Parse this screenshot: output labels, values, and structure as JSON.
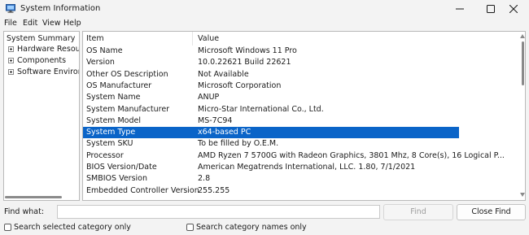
{
  "window": {
    "title": "System Information",
    "app_icon": "system-information-icon",
    "controls": [
      "minimize-icon",
      "maximize-icon",
      "close-icon"
    ]
  },
  "menu": [
    "File",
    "Edit",
    "View",
    "Help"
  ],
  "tree": {
    "root": "System Summary",
    "children": [
      "Hardware Resource",
      "Components",
      "Software Environme"
    ]
  },
  "list": {
    "columns": {
      "item": "Item",
      "value": "Value"
    },
    "selected_row": 8,
    "rows": [
      {
        "item": "OS Name",
        "value": "Microsoft Windows 11 Pro"
      },
      {
        "item": "Version",
        "value": "10.0.22621 Build 22621"
      },
      {
        "item": "Other OS Description",
        "value": "Not Available"
      },
      {
        "item": "OS Manufacturer",
        "value": "Microsoft Corporation"
      },
      {
        "item": "System Name",
        "value": "ANUP"
      },
      {
        "item": "System Manufacturer",
        "value": "Micro-Star International Co., Ltd."
      },
      {
        "item": "System Model",
        "value": "MS-7C94"
      },
      {
        "item": "System Type",
        "value": "x64-based PC"
      },
      {
        "item": "System SKU",
        "value": "To be filled by O.E.M."
      },
      {
        "item": "Processor",
        "value": "AMD Ryzen 7 5700G with Radeon Graphics, 3801 Mhz, 8 Core(s), 16 Logical P..."
      },
      {
        "item": "BIOS Version/Date",
        "value": "American Megatrends International, LLC. 1.80, 7/1/2021"
      },
      {
        "item": "SMBIOS Version",
        "value": "2.8"
      },
      {
        "item": "Embedded Controller Version",
        "value": "255.255"
      }
    ]
  },
  "find": {
    "label": "Find what:",
    "value": "",
    "find_button": "Find",
    "close_button": "Close Find",
    "search_selected": "Search selected category only",
    "search_names": "Search category names only"
  },
  "colors": {
    "selection": "#0a64c8",
    "window_bg": "#f3f3f3"
  }
}
